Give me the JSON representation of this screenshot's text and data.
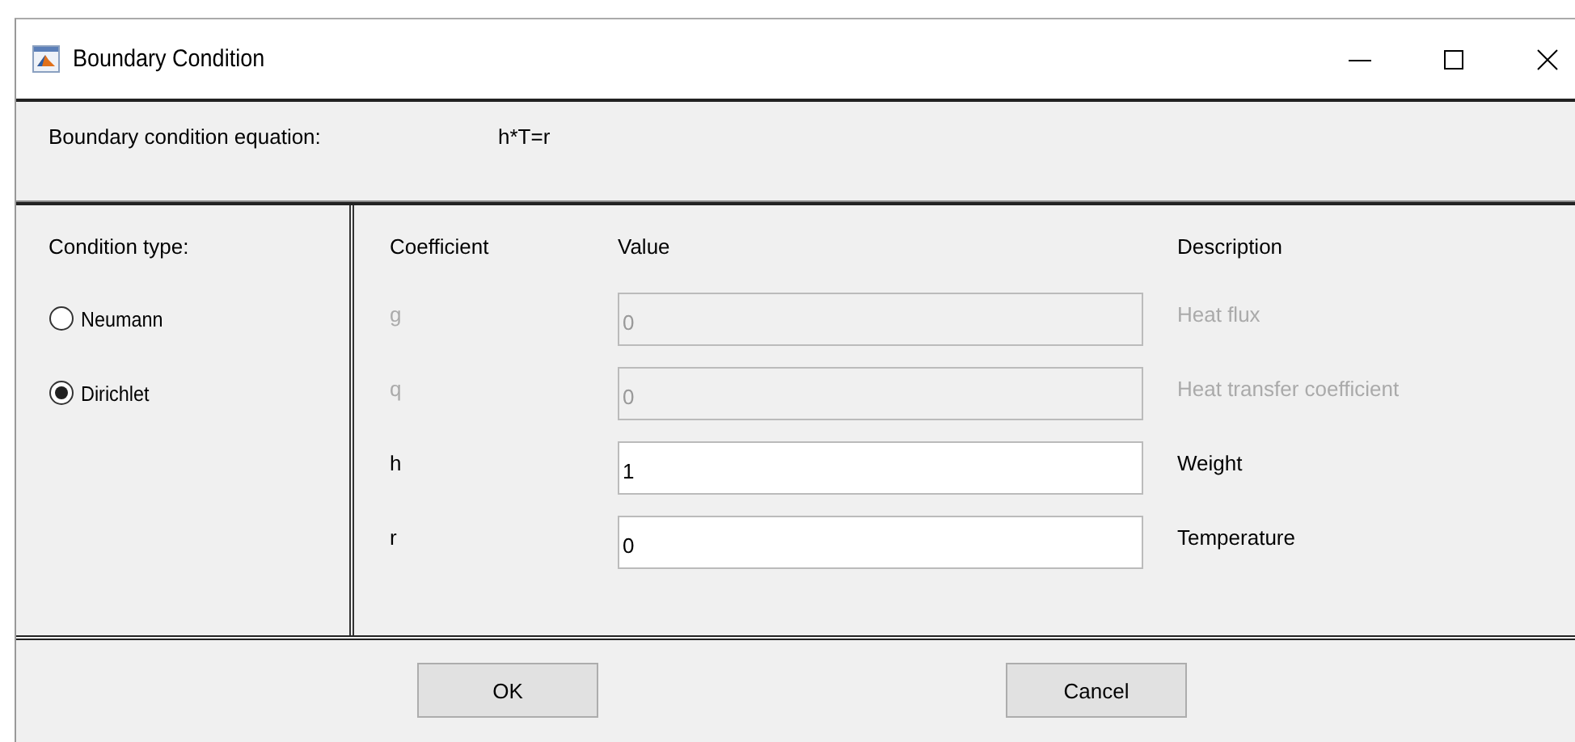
{
  "window": {
    "title": "Boundary Condition"
  },
  "equation": {
    "label": "Boundary condition equation:",
    "value": "h*T=r"
  },
  "condition_type": {
    "label": "Condition type:",
    "options": [
      {
        "label": "Neumann",
        "selected": false
      },
      {
        "label": "Dirichlet",
        "selected": true
      }
    ]
  },
  "coefficients": {
    "columns": [
      "Coefficient",
      "Value",
      "Description"
    ],
    "rows": [
      {
        "name": "g",
        "value": "0",
        "description": "Heat flux",
        "disabled": true
      },
      {
        "name": "q",
        "value": "0",
        "description": "Heat transfer coefficient",
        "disabled": true
      },
      {
        "name": "h",
        "value": "1",
        "description": "Weight",
        "disabled": false
      },
      {
        "name": "r",
        "value": "0",
        "description": "Temperature",
        "disabled": false
      }
    ]
  },
  "buttons": [
    "OK",
    "Cancel"
  ]
}
